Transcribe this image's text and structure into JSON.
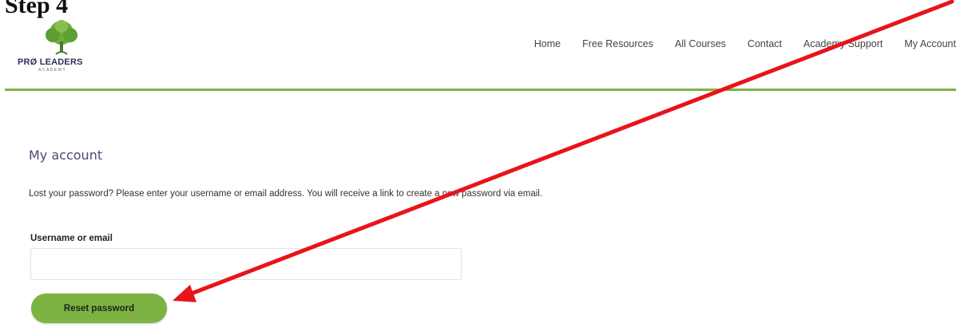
{
  "page_heading": "Step 4",
  "brand": {
    "name": "PRØ LEADERS",
    "sub": "ACADEMY"
  },
  "nav": {
    "items": [
      {
        "label": "Home"
      },
      {
        "label": "Free Resources"
      },
      {
        "label": "All Courses"
      },
      {
        "label": "Contact"
      },
      {
        "label": "Academy Support"
      },
      {
        "label": "My Account"
      }
    ]
  },
  "main": {
    "title": "My account",
    "description": "Lost your password? Please enter your username or email address. You will receive a link to create a new password via email.",
    "form": {
      "username_label": "Username or email",
      "username_value": "",
      "reset_label": "Reset password"
    }
  },
  "colors": {
    "accent": "#7cb342",
    "annotation_arrow": "#e8141a",
    "title": "#4a4a7a"
  },
  "icons": {
    "logo": "tree-icon",
    "annotation": "red-arrow-icon"
  }
}
